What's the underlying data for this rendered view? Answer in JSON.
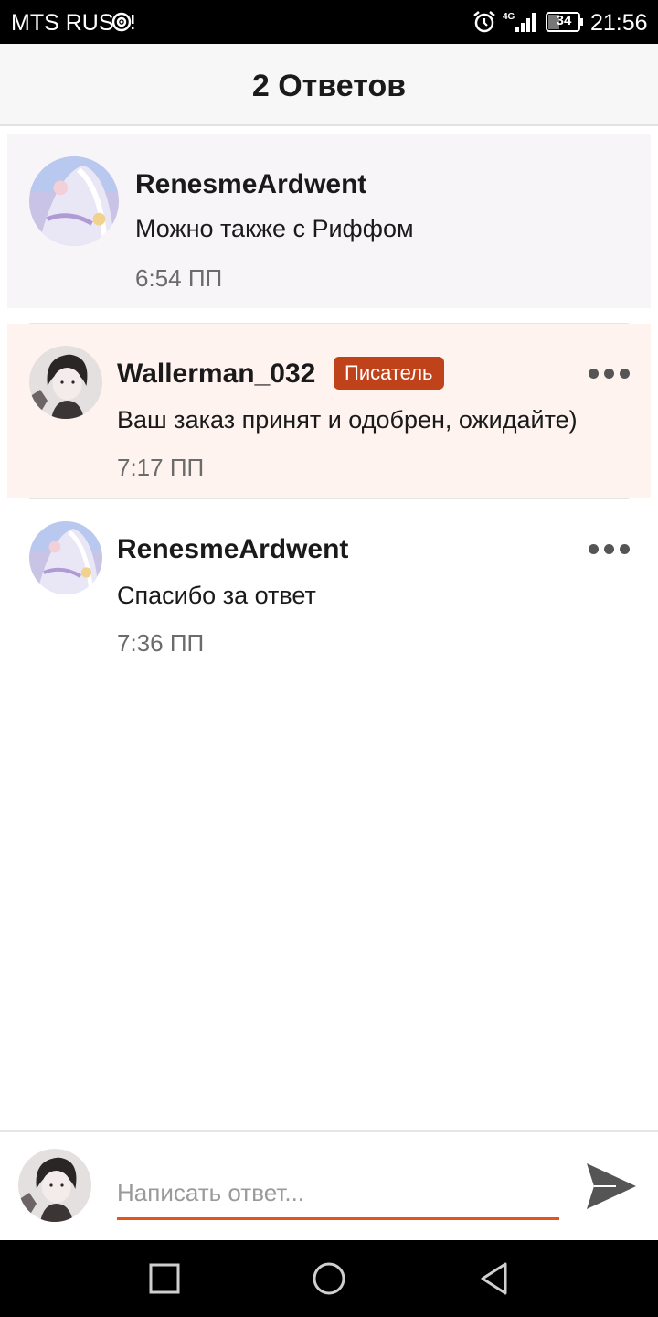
{
  "status_bar": {
    "carrier": "MTS RUS",
    "battery": "34",
    "clock": "21:56",
    "icons": [
      "hotspot-icon",
      "alarm-icon",
      "network-4g-signal-icon",
      "battery-icon"
    ]
  },
  "header": {
    "title": "2 Ответов"
  },
  "comments": [
    {
      "username": "RenesmeArdwent",
      "text": "Можно также с Риффом",
      "time": "6:54 ПП",
      "highlight": "#f7f5f8"
    },
    {
      "username": "Wallerman_032",
      "badge": "Писатель",
      "text": "Ваш заказ принят и одобрен, ожидайте)",
      "time": "7:17 ПП",
      "highlight": "#fff3ef"
    },
    {
      "username": "RenesmeArdwent",
      "text": "Спасибо за ответ",
      "time": "7:36 ПП",
      "highlight": "#ffffff"
    }
  ],
  "reply": {
    "placeholder": "Написать ответ...",
    "value": ""
  },
  "colors": {
    "accent": "#e8531c",
    "badge": "#c0421a",
    "send_icon": "#555555"
  },
  "nav_bar": {
    "icons": [
      "recent-apps-icon",
      "home-icon",
      "back-icon"
    ]
  }
}
